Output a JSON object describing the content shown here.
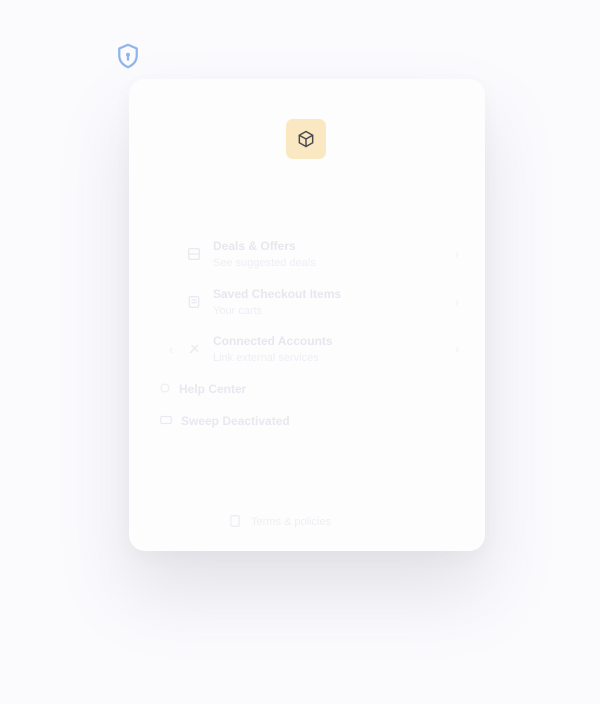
{
  "icons": {
    "shield": "shield-lock-icon",
    "box": "cube-icon"
  },
  "colors": {
    "background": "#fbfafd",
    "card": "#fefdfe",
    "shield_stroke": "#8fb5ea",
    "box_badge": "#f9e8c1",
    "box_stroke": "#4a4a4f"
  },
  "menu": {
    "items": [
      {
        "title": "Deals & Offers",
        "subtitle": "See suggested deals",
        "icon": "tag-icon"
      },
      {
        "title": "Saved Checkout Items",
        "subtitle": "Your carts",
        "icon": "cart-icon"
      },
      {
        "title": "Connected Accounts",
        "subtitle": "Link external services",
        "icon": "link-icon"
      }
    ],
    "extras": [
      {
        "label": "Help Center",
        "icon": "help-icon"
      },
      {
        "label": "Sweep Deactivated",
        "icon": "sweep-icon"
      }
    ]
  },
  "footer": {
    "label": "Terms & policies"
  }
}
